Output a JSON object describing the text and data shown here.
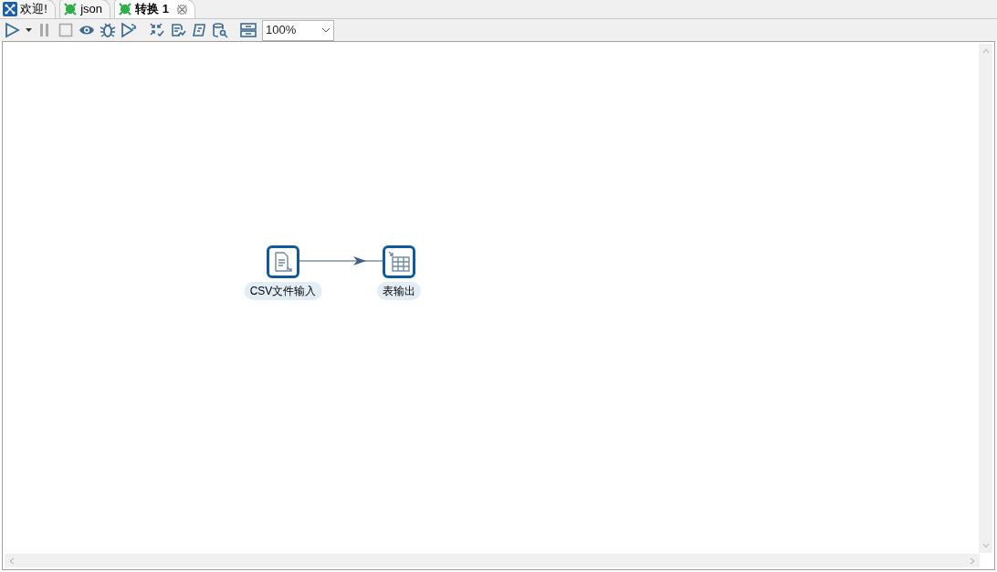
{
  "tabs": [
    {
      "label": "欢迎!",
      "kind": "welcome",
      "selected": false
    },
    {
      "label": "json",
      "kind": "transformation",
      "selected": false
    },
    {
      "label": "转换 1",
      "kind": "transformation",
      "selected": true
    }
  ],
  "toolbar": [
    {
      "kind": "run",
      "disabled": false
    },
    {
      "kind": "caret"
    },
    {
      "kind": "pause",
      "disabled": true
    },
    {
      "kind": "stop",
      "disabled": true
    },
    {
      "kind": "preview",
      "disabled": false
    },
    {
      "kind": "debug",
      "disabled": false
    },
    {
      "kind": "replay",
      "disabled": false
    },
    {
      "kind": "sep"
    },
    {
      "kind": "verify",
      "disabled": false
    },
    {
      "kind": "impact",
      "disabled": false
    },
    {
      "kind": "sql",
      "disabled": false
    },
    {
      "kind": "explore",
      "disabled": false
    },
    {
      "kind": "sep"
    },
    {
      "kind": "layout",
      "disabled": false
    }
  ],
  "zoom": {
    "value": "100%"
  },
  "steps": [
    {
      "label": "CSV文件输入",
      "kind": "file-input"
    },
    {
      "label": "表输出",
      "kind": "table-output"
    }
  ],
  "hops": [
    {
      "kind": "arrow"
    }
  ]
}
